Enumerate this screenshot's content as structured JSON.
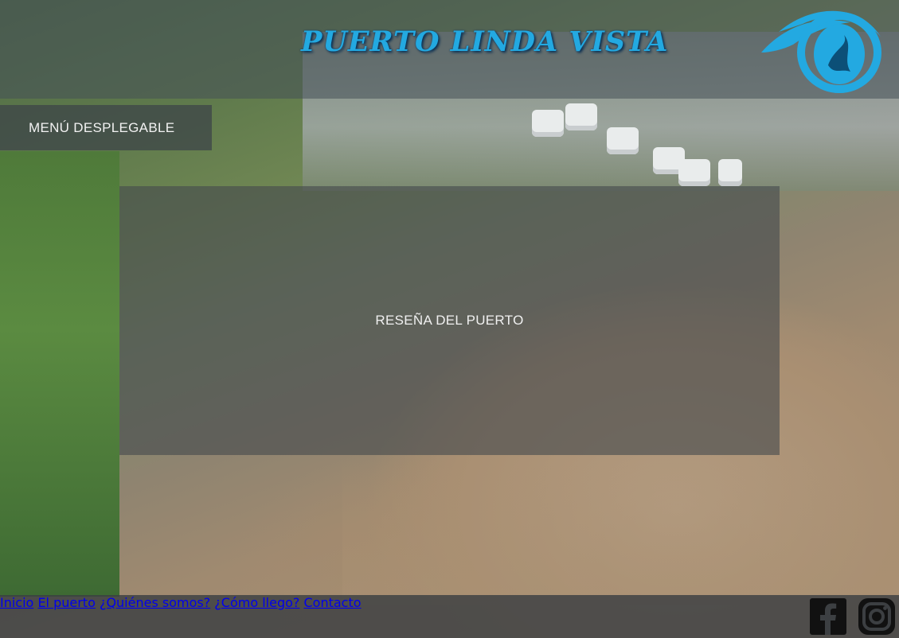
{
  "header": {
    "title": "PUERTO LINDA VISTA",
    "logo_icon": "eye-wave-logo",
    "accent_color": "#23a9e1"
  },
  "menu": {
    "label": "MENÚ DESPLEGABLE"
  },
  "main": {
    "panel_text": "RESEÑA DEL PUERTO"
  },
  "footer": {
    "nav": [
      {
        "label": "Inicio"
      },
      {
        "label": "El puerto"
      },
      {
        "label": "¿Quiénes somos?"
      },
      {
        "label": "¿Cómo llego?"
      },
      {
        "label": "Contacto"
      }
    ],
    "social": [
      {
        "icon": "facebook-icon"
      },
      {
        "icon": "instagram-icon"
      }
    ]
  }
}
